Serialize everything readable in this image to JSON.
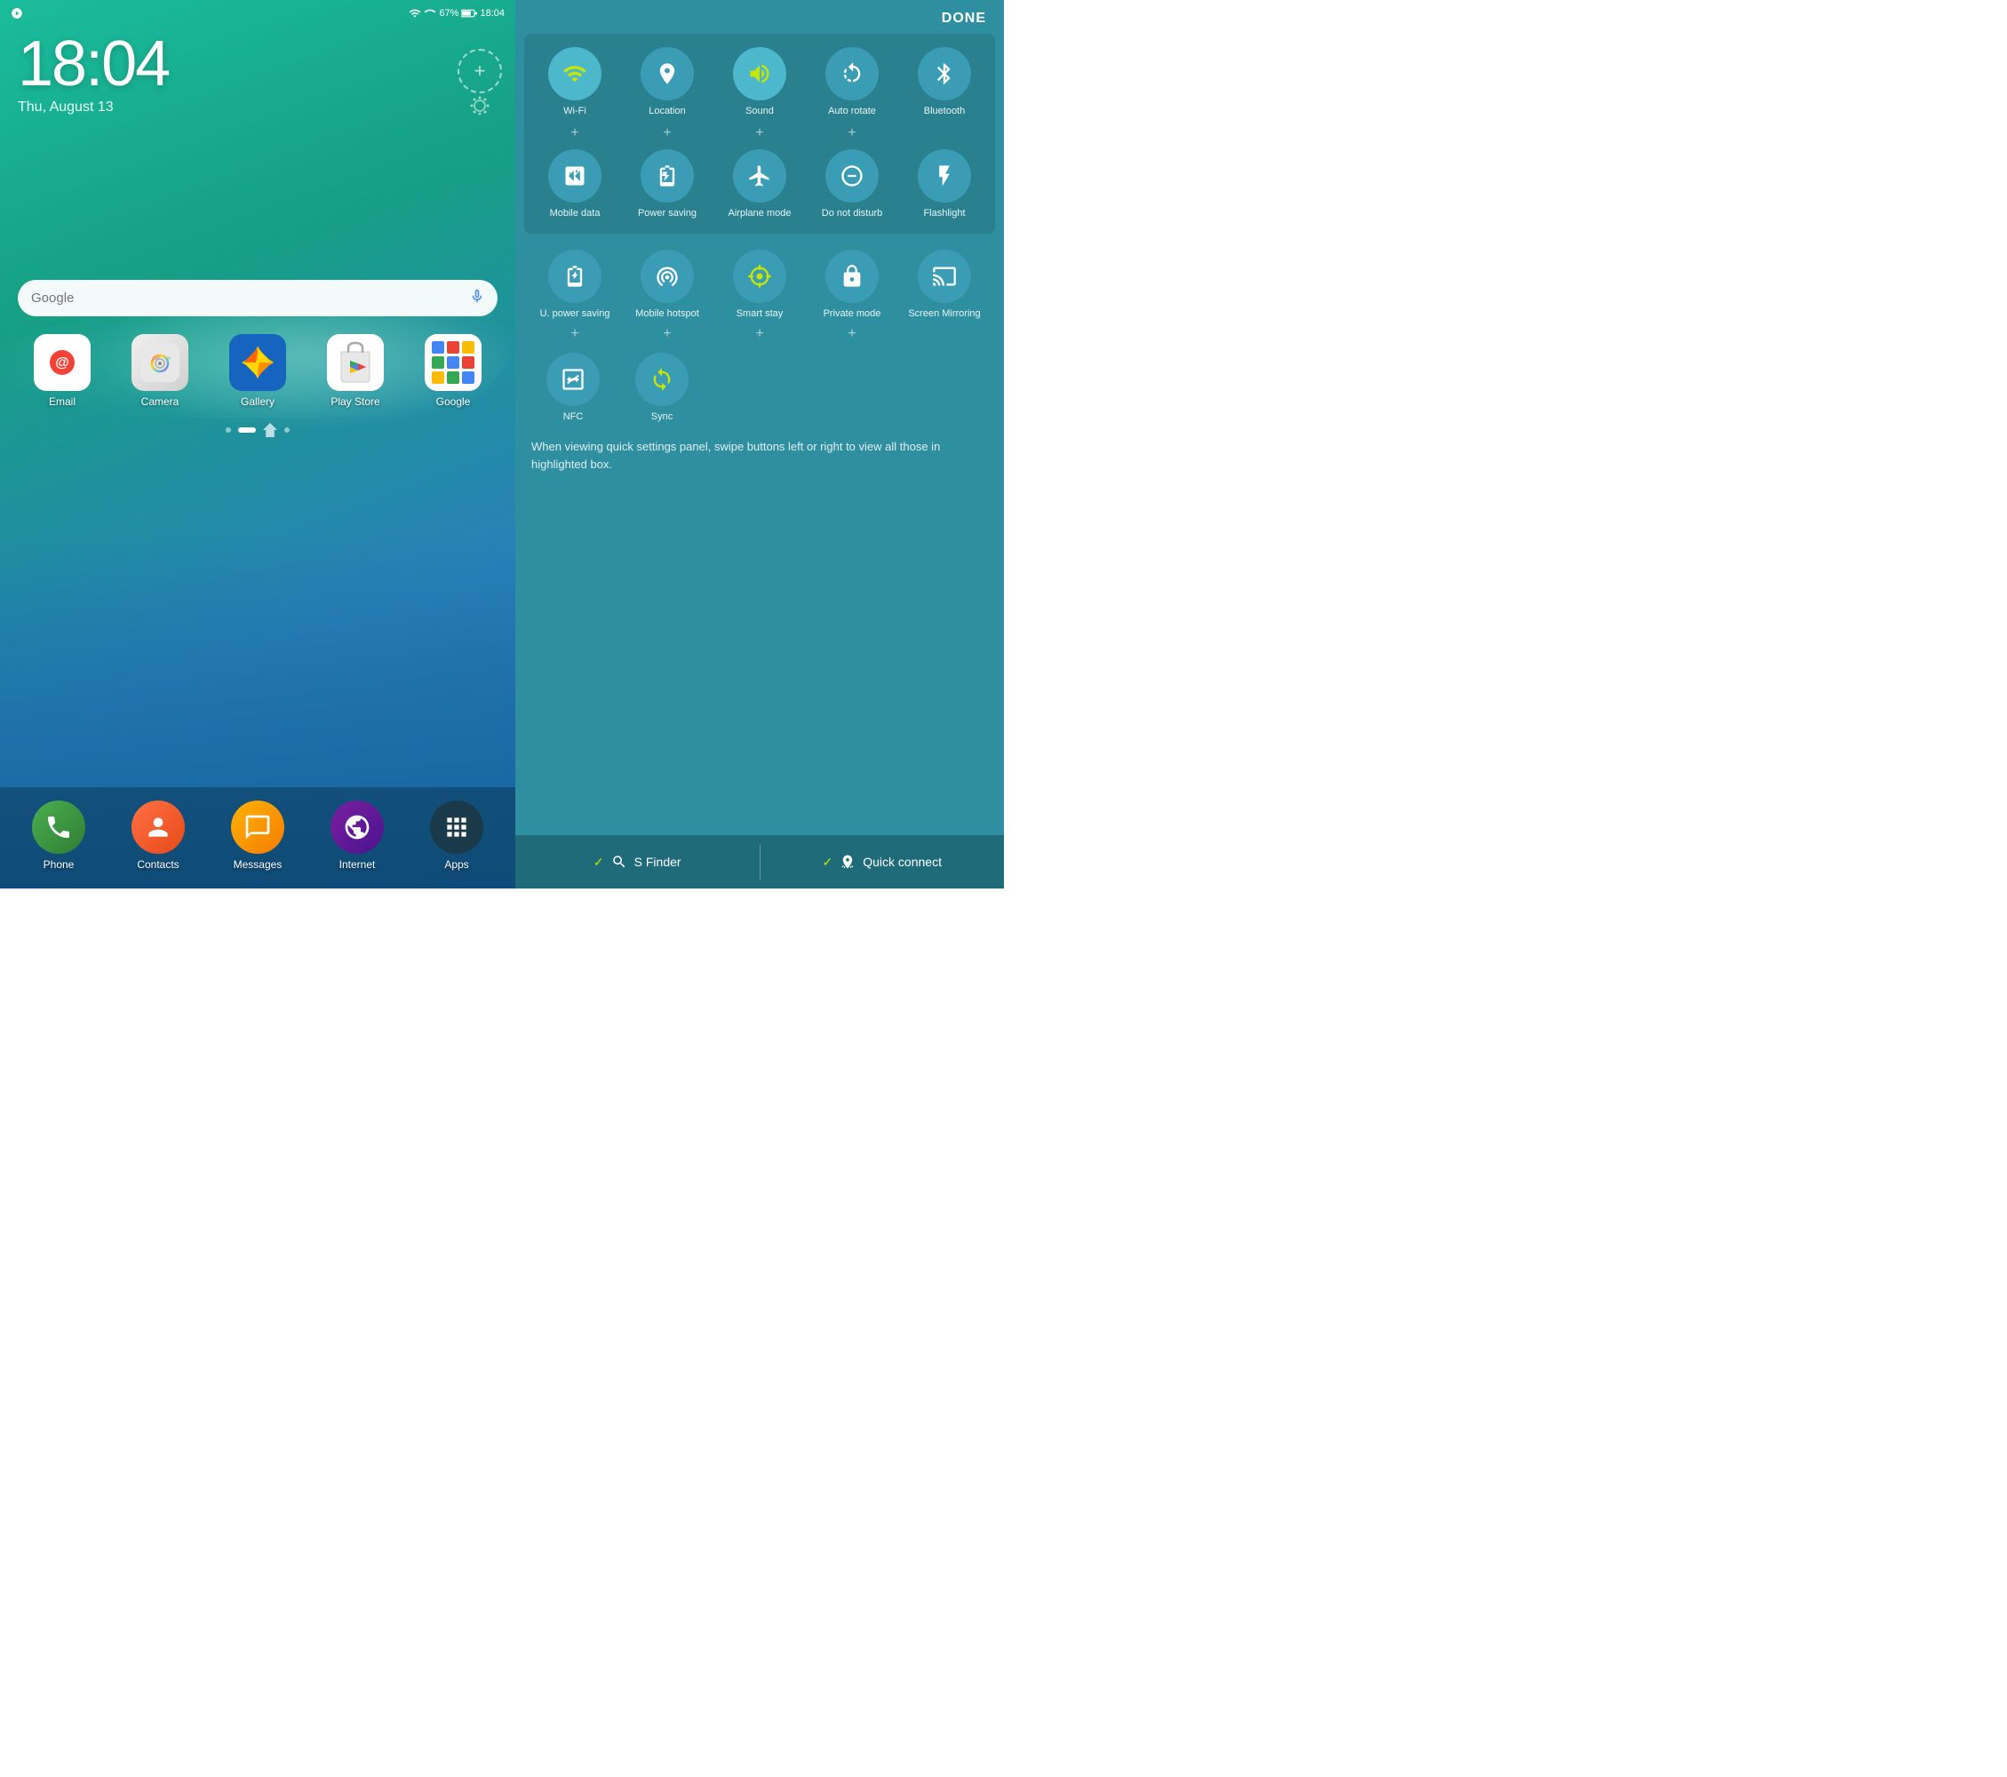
{
  "leftPanel": {
    "statusBar": {
      "time": "18:04",
      "battery": "67%",
      "downloadIcon": "download-icon"
    },
    "clock": {
      "time": "18:04",
      "date": "Thu, August 13"
    },
    "search": {
      "placeholder": "Google",
      "logo": "Google"
    },
    "apps": [
      {
        "name": "Email",
        "icon": "email-icon"
      },
      {
        "name": "Camera",
        "icon": "camera-icon"
      },
      {
        "name": "Gallery",
        "icon": "gallery-icon"
      },
      {
        "name": "Play Store",
        "icon": "playstore-icon"
      },
      {
        "name": "Google",
        "icon": "google-icon"
      }
    ],
    "dock": [
      {
        "name": "Phone",
        "icon": "phone-icon"
      },
      {
        "name": "Contacts",
        "icon": "contacts-icon"
      },
      {
        "name": "Messages",
        "icon": "messages-icon"
      },
      {
        "name": "Internet",
        "icon": "internet-icon"
      },
      {
        "name": "Apps",
        "icon": "apps-icon"
      }
    ]
  },
  "rightPanel": {
    "doneButton": "DONE",
    "quickSettings": {
      "row1": [
        {
          "label": "Wi-Fi",
          "icon": "wifi-icon",
          "active": true
        },
        {
          "label": "Location",
          "icon": "location-icon",
          "active": false
        },
        {
          "label": "Sound",
          "icon": "sound-icon",
          "active": true
        },
        {
          "label": "Auto rotate",
          "icon": "autorotate-icon",
          "active": false
        },
        {
          "label": "Bluetooth",
          "icon": "bluetooth-icon",
          "active": false
        }
      ],
      "row2": [
        {
          "label": "Mobile data",
          "icon": "mobiledata-icon",
          "active": false
        },
        {
          "label": "Power saving",
          "icon": "powersaving-icon",
          "active": false
        },
        {
          "label": "Airplane mode",
          "icon": "airplane-icon",
          "active": false
        },
        {
          "label": "Do not disturb",
          "icon": "donotdisturb-icon",
          "active": false
        },
        {
          "label": "Flashlight",
          "icon": "flashlight-icon",
          "active": false
        }
      ],
      "row3": [
        {
          "label": "U. power saving",
          "icon": "upowersaving-icon",
          "active": false
        },
        {
          "label": "Mobile hotspot",
          "icon": "hotspot-icon",
          "active": false
        },
        {
          "label": "Smart stay",
          "icon": "smartstay-icon",
          "active": true
        },
        {
          "label": "Private mode",
          "icon": "privatemode-icon",
          "active": false
        },
        {
          "label": "Screen Mirroring",
          "icon": "screenmirroring-icon",
          "active": false
        }
      ],
      "row4": [
        {
          "label": "NFC",
          "icon": "nfc-icon",
          "active": false
        },
        {
          "label": "Sync",
          "icon": "sync-icon",
          "active": true
        }
      ]
    },
    "infoText": "When viewing quick settings panel, swipe buttons left or right to view all those in highlighted box.",
    "bottomBar": {
      "left": "S Finder",
      "right": "Quick connect"
    }
  }
}
